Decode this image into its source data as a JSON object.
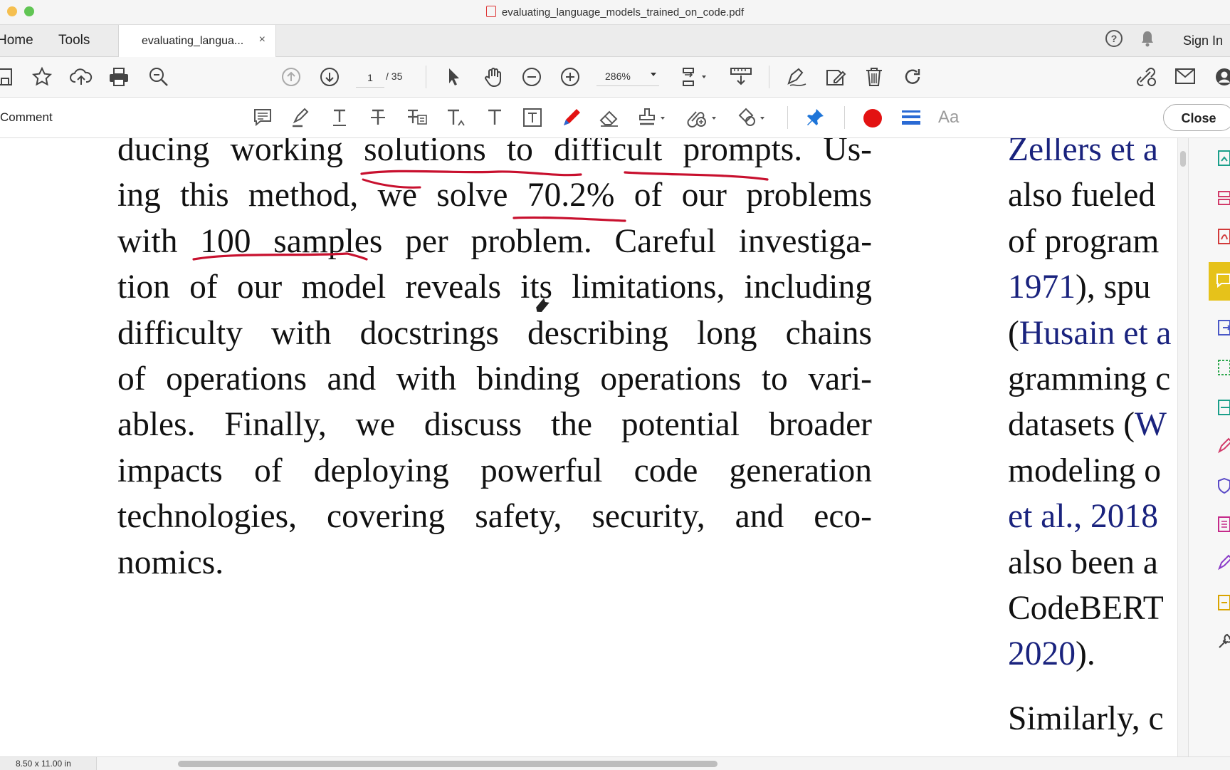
{
  "window": {
    "title": "evaluating_language_models_trained_on_code.pdf",
    "traffic_colors": [
      "#f5bf4f",
      "#61c554"
    ]
  },
  "tabs": {
    "home": "Home",
    "tools": "Tools",
    "document_tab": "evaluating_langua...",
    "close_glyph": "×",
    "sign_in": "Sign In"
  },
  "toolbar": {
    "page_current": "1",
    "page_total": "/ 35",
    "zoom": "286%"
  },
  "comment_bar": {
    "label": "Comment",
    "text_style_label": "Aa",
    "close_label": "Close",
    "pen_color": "#e31212"
  },
  "document": {
    "col1": {
      "line1_a": "ducing working ",
      "line1_b": "solutions to difficult prompts",
      "line1_c": ". Us-",
      "line2_a": "ing this method, we solve ",
      "line2_b": "70.2%",
      "line2_c": " of our problems",
      "line3_a": "with ",
      "line3_b": "100 samples",
      "line3_c": " per problem. Careful investiga-",
      "line4": "tion of our model reveals its limitations, including",
      "line5": "difficulty with docstrings describing long chains",
      "line6": "of operations and with binding operations to vari-",
      "line7": "ables.  Finally, we discuss the potential broader",
      "line8": "impacts of deploying powerful code generation",
      "line9": "technologies, covering safety, security, and eco-",
      "line10": "nomics."
    },
    "col2": {
      "line1": "Zellers et a",
      "line2": "also fueled",
      "line3": "of program",
      "line4_cite": "1971",
      "line4_rest": "), spu",
      "line5_open": "(",
      "line5_cite": "Husain et a",
      "line6": "gramming c",
      "line7_a": "datasets (",
      "line7_cite": "W",
      "line8": "modeling o",
      "line9_cite": "et al., 2018",
      "line10": "also been a",
      "line11": "CodeBERT",
      "line12_cite": "2020",
      "line12_rest": ").",
      "line13": "Similarly, c"
    }
  },
  "status": {
    "page_size": "8.50 x 11.00 in"
  }
}
